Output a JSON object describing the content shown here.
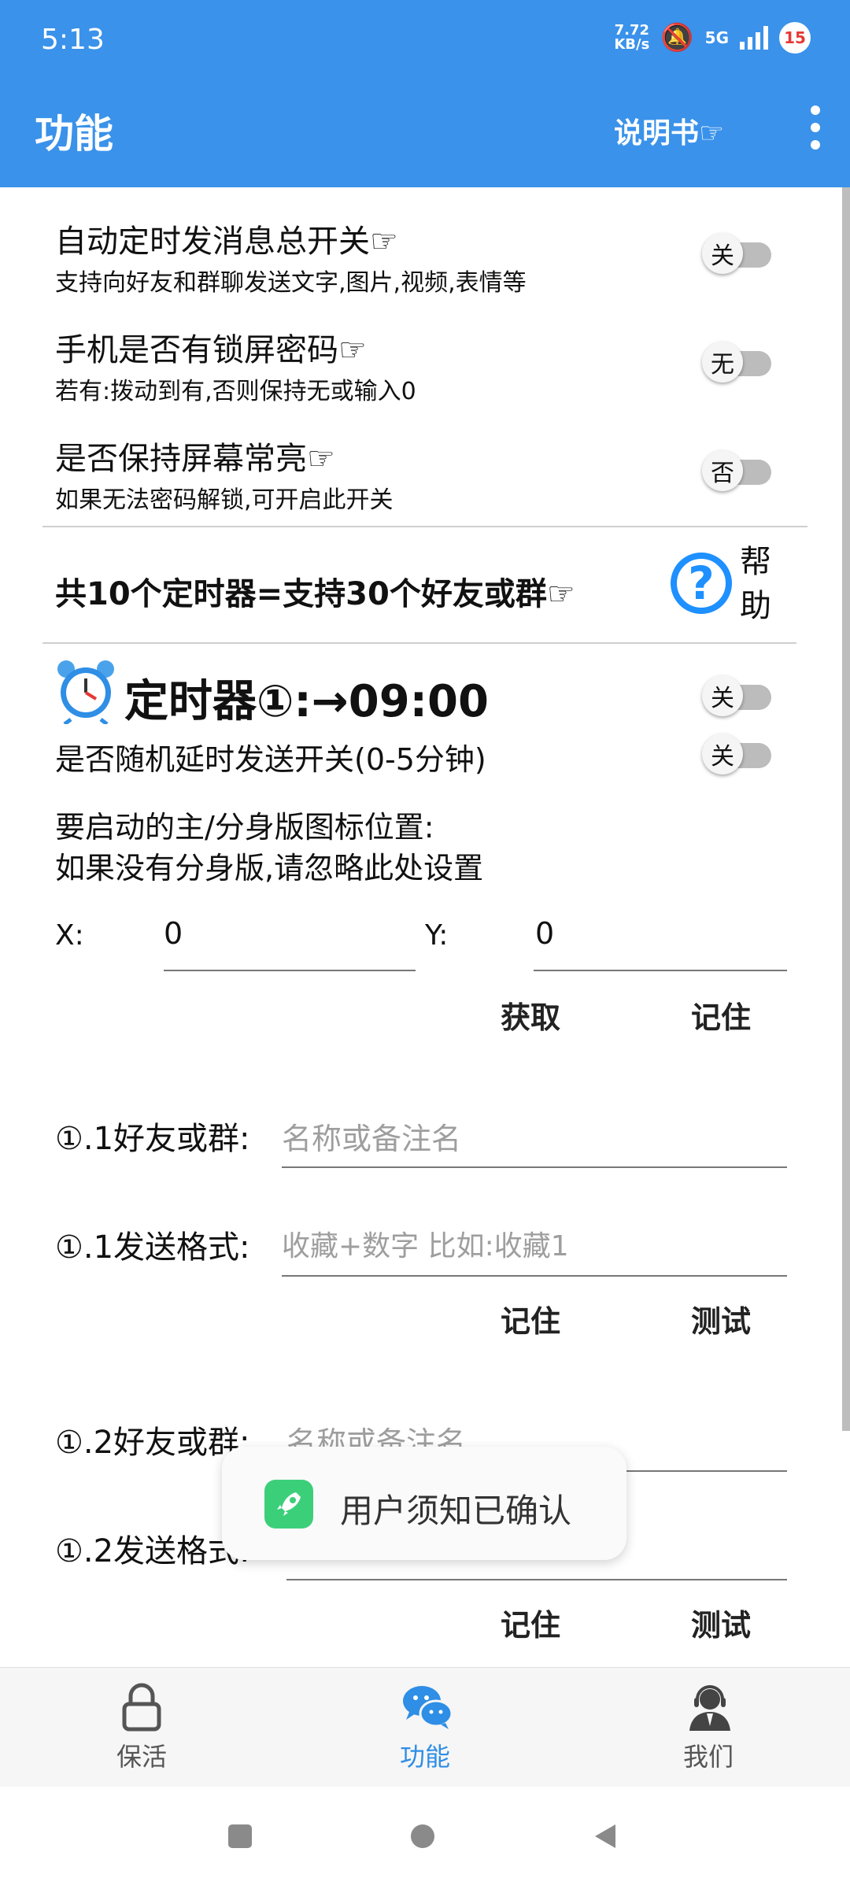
{
  "status_bar": {
    "time": "5:13",
    "net_speed_value": "7.72",
    "net_speed_unit": "KB/s",
    "network": "5G",
    "notification_count": "15"
  },
  "app_bar": {
    "title": "功能",
    "manual_label": "说明书☞",
    "menu_icon": "more-vert-icon",
    "color": "#3a92ea"
  },
  "settings": [
    {
      "title": "自动定时发消息总开关☞",
      "subtitle": "支持向好友和群聊发送文字,图片,视频,表情等",
      "toggle": "关"
    },
    {
      "title": "手机是否有锁屏密码☞",
      "subtitle": "若有:拨动到有,否则保持无或输入0",
      "toggle": "无"
    },
    {
      "title": "是否保持屏幕常亮☞",
      "subtitle": "如果无法密码解锁,可开启此开关",
      "toggle": "否"
    }
  ],
  "timers_summary": {
    "text": "共10个定时器=支持30个好友或群☞",
    "help_label_1": "帮",
    "help_label_2": "助",
    "help_icon": "help-circle-icon"
  },
  "timer1": {
    "title": "定时器①:→09:00",
    "toggle": "关",
    "random_delay_label": "是否随机延时发送开关(0-5分钟)",
    "random_delay_toggle": "关",
    "icon_position_line1": "要启动的主/分身版图标位置:",
    "icon_position_line2": "如果没有分身版,请忽略此处设置",
    "x_label": "X:",
    "x_value": "0",
    "y_label": "Y:",
    "y_value": "0",
    "get_button": "获取",
    "remember_button": "记住",
    "entries": [
      {
        "friend_label": "①.1好友或群:",
        "friend_placeholder": "名称或备注名",
        "format_label": "①.1发送格式:",
        "format_placeholder": "收藏+数字 比如:收藏1",
        "remember": "记住",
        "test": "测试"
      },
      {
        "friend_label": "①.2好友或群:",
        "friend_placeholder": "名称或备注名",
        "format_label": "①.2发送格式:",
        "format_placeholder": "",
        "remember": "记住",
        "test": "测试"
      }
    ]
  },
  "toast": {
    "text": "用户须知已确认",
    "icon": "rocket-app-icon"
  },
  "bottom_nav": [
    {
      "label": "保活",
      "icon": "lock-icon",
      "active": false
    },
    {
      "label": "功能",
      "icon": "wechat-chat-icon",
      "active": true
    },
    {
      "label": "我们",
      "icon": "support-agent-icon",
      "active": false
    }
  ]
}
